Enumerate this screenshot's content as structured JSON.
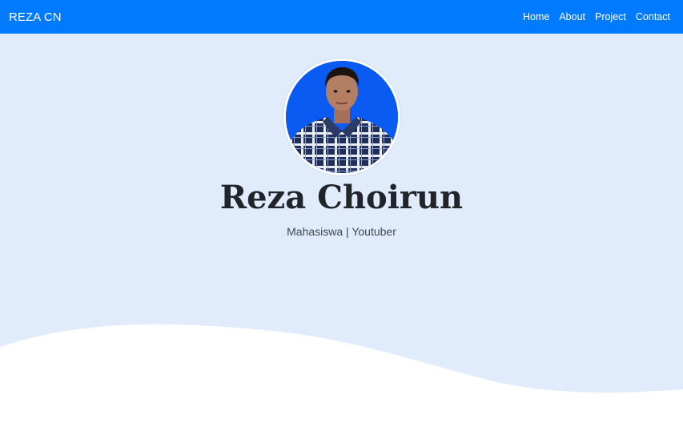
{
  "navbar": {
    "brand": "REZA CN",
    "links": [
      "Home",
      "About",
      "Project",
      "Contact"
    ]
  },
  "hero": {
    "name": "Reza Choirun",
    "tagline": "Mahasiswa | Youtuber"
  },
  "colors": {
    "navbar_bg": "#007bff",
    "hero_bg": "#e0ecfc",
    "avatar_bg": "#0a5bf2",
    "heading_text": "#212529"
  }
}
